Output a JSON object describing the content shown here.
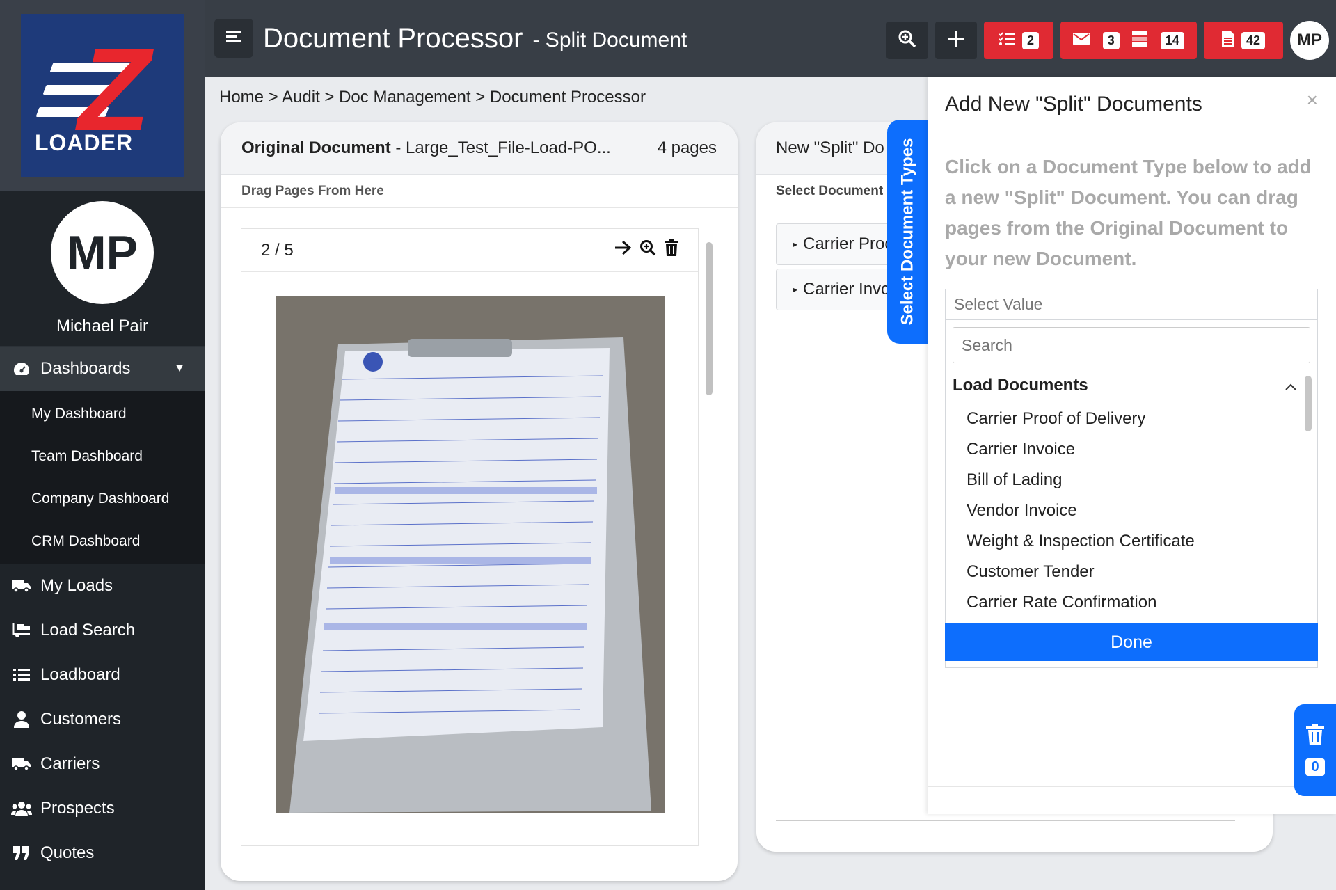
{
  "app": {
    "logo_text": "LOADER",
    "title": "Document Processor",
    "subtitle": "- Split Document"
  },
  "user": {
    "initials": "MP",
    "name": "Michael Pair"
  },
  "topbar": {
    "badges": {
      "tasks": "2",
      "mail": "3",
      "loads": "14",
      "docs": "42"
    }
  },
  "sidebar": {
    "dashboards_label": "Dashboards",
    "sub_items": [
      "My Dashboard",
      "Team Dashboard",
      "Company Dashboard",
      "CRM Dashboard"
    ],
    "items": [
      {
        "label": "My Loads",
        "icon": "truck-icon"
      },
      {
        "label": "Load Search",
        "icon": "truck-loading-icon"
      },
      {
        "label": "Loadboard",
        "icon": "list-icon"
      },
      {
        "label": "Customers",
        "icon": "user-icon"
      },
      {
        "label": "Carriers",
        "icon": "truck-icon"
      },
      {
        "label": "Prospects",
        "icon": "users-icon"
      },
      {
        "label": "Quotes",
        "icon": "quote-icon"
      }
    ]
  },
  "breadcrumb": "Home > Audit > Doc Management > Document Processor",
  "original": {
    "label": "Original Document",
    "filename": "- Large_Test_File-Load-PO...",
    "pages": "4 pages",
    "drag_hint": "Drag Pages From Here",
    "page_indicator": "2 / 5"
  },
  "split": {
    "title": "New \"Split\" Do",
    "sub": "Select Document",
    "rows": [
      "Carrier Proo",
      "Carrier Invo"
    ]
  },
  "tab": {
    "label": "Select Document Types"
  },
  "panel": {
    "title": "Add New \"Split\" Documents",
    "close": "×",
    "description": "Click on a Document Type below to add a new \"Split\" Document. You can drag pages from the Original Document to your new Document.",
    "select_value": "Select Value",
    "search_placeholder": "Search",
    "group": "Load Documents",
    "options": [
      "Carrier Proof of Delivery",
      "Carrier Invoice",
      "Bill of Lading",
      "Vendor Invoice",
      "Weight & Inspection Certificate",
      "Customer Tender",
      "Carrier Rate Confirmation"
    ],
    "done": "Done"
  },
  "trash": {
    "count": "0"
  },
  "colors": {
    "accent": "#0d6efd",
    "danger": "#e02a33",
    "sidebar": "#1f2429",
    "topbar": "#383e46"
  }
}
